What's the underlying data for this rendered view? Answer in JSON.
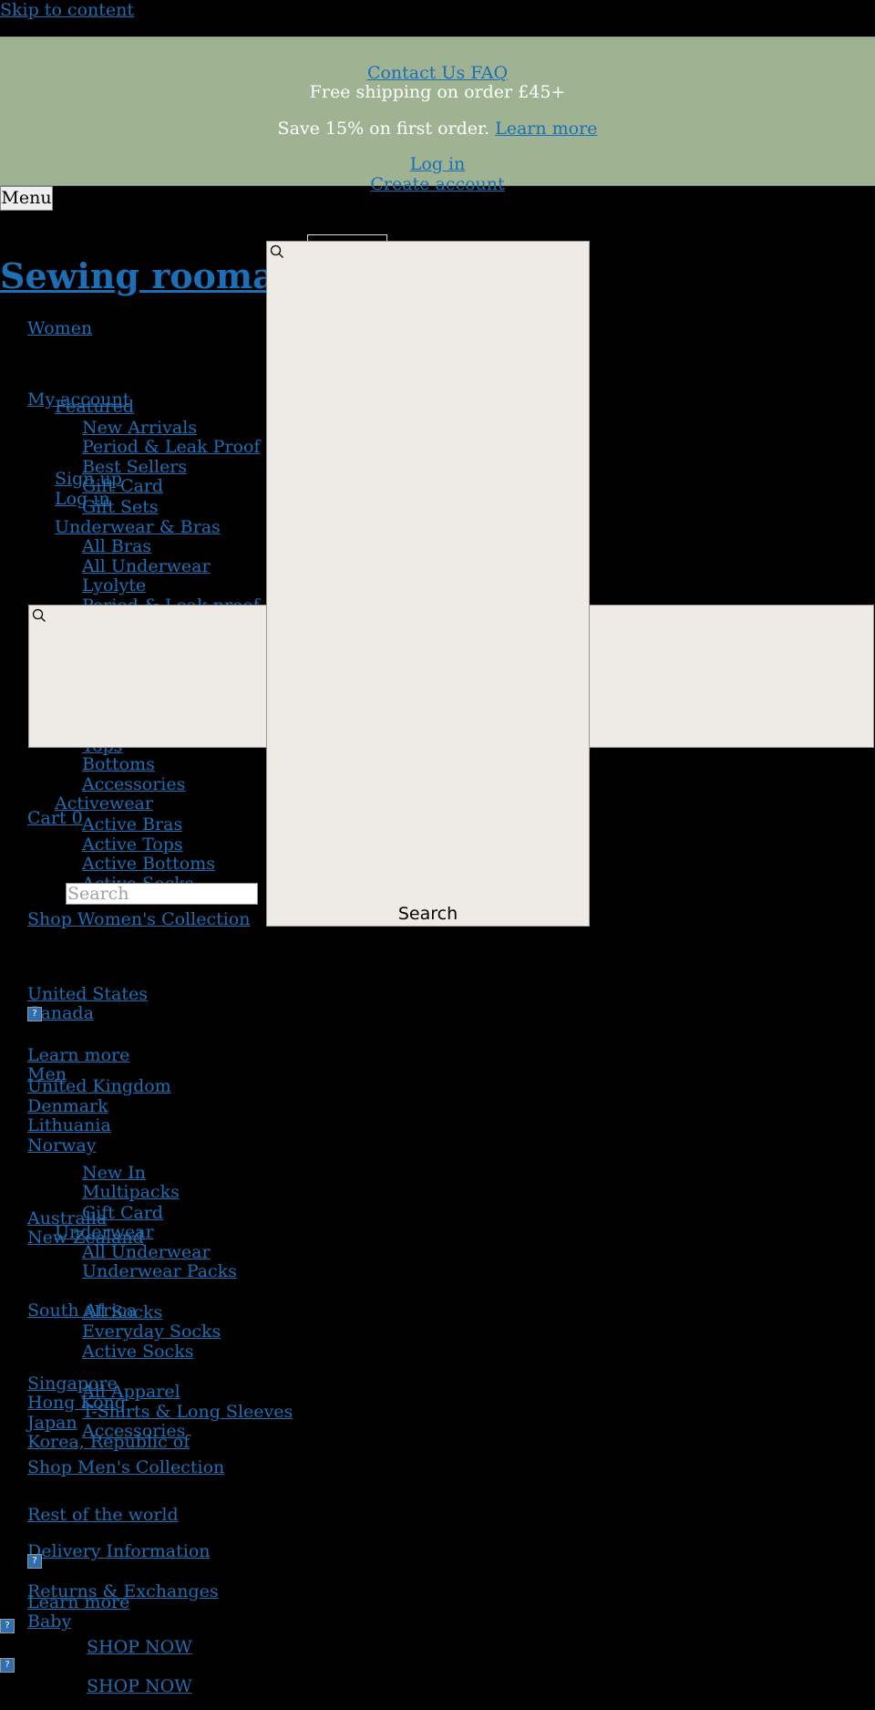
{
  "skip_link": "Skip to content",
  "colors": {
    "banner_bg": "#9fb393",
    "link": "#1c6fb5",
    "panel_bg": "#eeebe6"
  },
  "banner": {
    "contact_faq": "Contact Us FAQ",
    "free_shipping": "Free shipping on order £45+",
    "save_text": "Save 15% on first order.",
    "learn_more": "Learn more",
    "log_in": "Log in",
    "create_account": "Create account"
  },
  "menu_button": "Menu",
  "site_title": "Sewing roomat",
  "nav": {
    "women": "Women",
    "my_account": "My account",
    "sign_up": "Sign up",
    "log_in": "Log in",
    "cart": "Cart 0",
    "featured": {
      "label": "Featured",
      "items": [
        "New Arrivals",
        "Period & Leak Proof",
        "Best Sellers",
        "Gift Card",
        "Gift Sets"
      ]
    },
    "underwear_bras": {
      "label": "Underwear & Bras",
      "items": [
        "All Bras",
        "All Underwear",
        "Lyolyte",
        "Period & Leak proof"
      ]
    },
    "apparel": {
      "items": [
        "Tops",
        "Bottoms",
        "Accessories"
      ]
    },
    "activewear": {
      "label": "Activewear",
      "items": [
        "Active Bras",
        "Active Tops",
        "Active Bottoms",
        "Active Socks"
      ]
    },
    "shop_women": "Shop Women's Collection",
    "learn_more": "Learn more",
    "men": "Men",
    "men_featured": [
      "New In",
      "Multipacks",
      "Gift Card"
    ],
    "men_underwear": {
      "label": "Underwear",
      "items": [
        "All Underwear",
        "Underwear Packs"
      ]
    },
    "men_socks": [
      "All Socks",
      "Everyday Socks",
      "Active Socks"
    ],
    "men_apparel": [
      "All Apparel",
      "T-Shirts & Long Sleeves",
      "Accessories"
    ],
    "shop_men": "Shop Men's Collection",
    "learn_more_2": "Learn more",
    "baby": "Baby",
    "shop_now": [
      "SHOP NOW",
      "SHOP NOW"
    ]
  },
  "countries": [
    "United States",
    "Canada",
    "United Kingdom",
    "Denmark",
    "Lithuania",
    "Norway",
    "Australia",
    "New Zealand",
    "South Africa",
    "Singapore",
    "Hong Kong",
    "Japan",
    "Korea, Republic of",
    "Rest of the world"
  ],
  "footer_links": [
    "Delivery Information",
    "Returns & Exchanges"
  ],
  "search": {
    "placeholder": "Search",
    "panel_label": "Search"
  },
  "icons": {
    "search": "magnifier-icon",
    "broken_image": "broken-image-icon"
  }
}
